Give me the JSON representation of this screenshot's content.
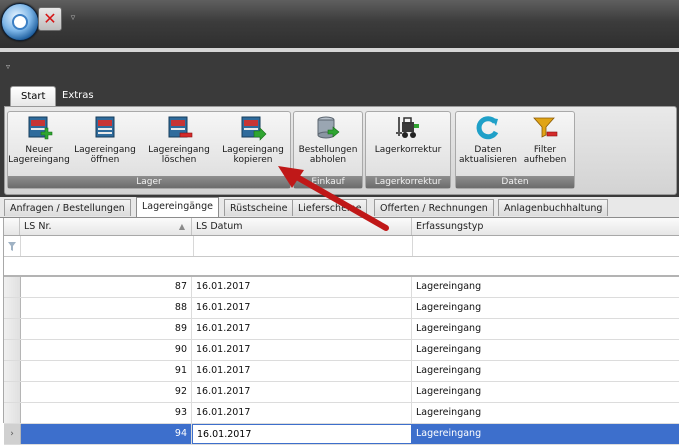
{
  "colors": {
    "titlebar": "#3c3c3c",
    "selection": "#3d6fcc",
    "annotation_arrow": "#c01818"
  },
  "titlebar": {
    "app_icon": "app-orb-icon",
    "close_icon": "close-x-icon",
    "dropdown_glyph": "▿"
  },
  "ribbon": {
    "collapse_glyph": "▿",
    "tabs": [
      {
        "label": "Start",
        "active": true
      },
      {
        "label": "Extras",
        "active": false
      }
    ],
    "groups": [
      {
        "label": "Lager",
        "buttons": [
          {
            "label": "Neuer Lagereingang",
            "icon": "new-goods-receipt-icon"
          },
          {
            "label": "Lagereingang öffnen",
            "icon": "open-goods-receipt-icon"
          },
          {
            "label": "Lagereingang löschen",
            "icon": "delete-goods-receipt-icon"
          },
          {
            "label": "Lagereingang kopieren",
            "icon": "copy-goods-receipt-icon"
          }
        ]
      },
      {
        "label": "Einkauf",
        "buttons": [
          {
            "label": "Bestellungen abholen",
            "icon": "database-fetch-icon"
          }
        ]
      },
      {
        "label": "Lagerkorrektur",
        "buttons": [
          {
            "label": "Lagerkorrektur",
            "icon": "forklift-icon"
          }
        ]
      },
      {
        "label": "Daten",
        "buttons": [
          {
            "label": "Daten aktualisieren",
            "icon": "refresh-icon"
          },
          {
            "label": "Filter aufheben",
            "icon": "clear-filter-icon"
          }
        ]
      }
    ]
  },
  "doc_tabs": [
    {
      "label": "Anfragen / Bestellungen",
      "active": false
    },
    {
      "label": "Lagereingänge",
      "active": true
    },
    {
      "label": "Rüstscheine",
      "active": false
    },
    {
      "label": "Lieferscheine",
      "active": false
    },
    {
      "label": "Offerten / Rechnungen",
      "active": false
    },
    {
      "label": "Anlagenbuchhaltung",
      "active": false
    }
  ],
  "grid": {
    "columns": [
      {
        "label": "LS Nr.",
        "sort": "▲"
      },
      {
        "label": "LS Datum"
      },
      {
        "label": "Erfassungstyp"
      }
    ],
    "filter_icon": "funnel-icon",
    "rows": [
      {
        "nr": "87",
        "datum": "16.01.2017",
        "typ": "Lagereingang"
      },
      {
        "nr": "88",
        "datum": "16.01.2017",
        "typ": "Lagereingang"
      },
      {
        "nr": "89",
        "datum": "16.01.2017",
        "typ": "Lagereingang"
      },
      {
        "nr": "90",
        "datum": "16.01.2017",
        "typ": "Lagereingang"
      },
      {
        "nr": "91",
        "datum": "16.01.2017",
        "typ": "Lagereingang"
      },
      {
        "nr": "92",
        "datum": "16.01.2017",
        "typ": "Lagereingang"
      },
      {
        "nr": "93",
        "datum": "16.01.2017",
        "typ": "Lagereingang"
      },
      {
        "nr": "94",
        "datum": "16.01.2017",
        "typ": "Lagereingang",
        "selected": true,
        "indicator": "›"
      }
    ]
  }
}
